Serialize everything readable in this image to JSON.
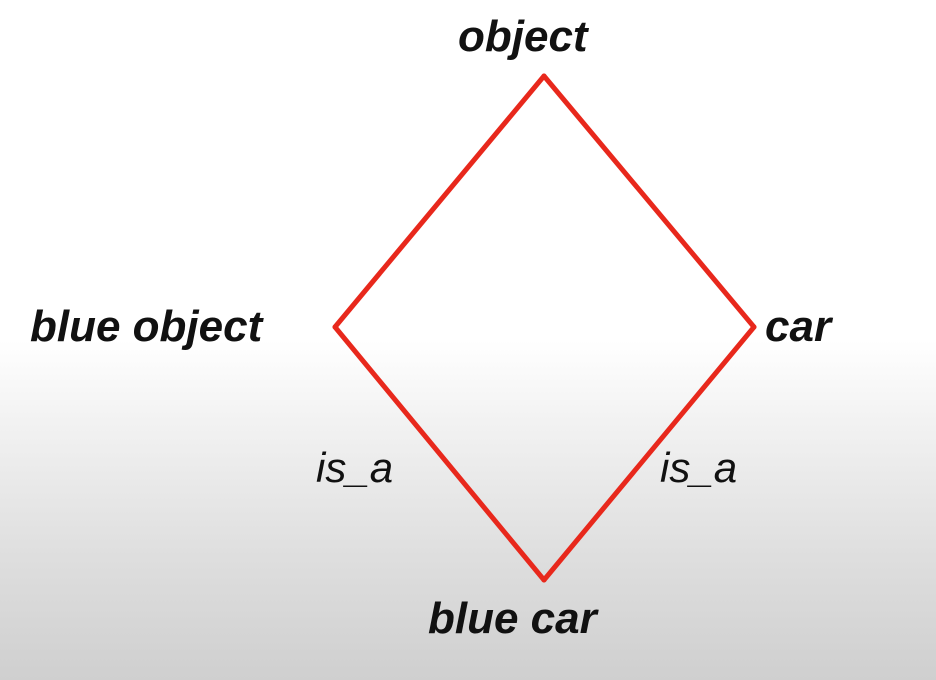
{
  "diagram": {
    "nodes": {
      "top": "object",
      "left": "blue object",
      "right": "car",
      "bottom": "blue car"
    },
    "edges": [
      {
        "from": "blue car",
        "to": "blue object",
        "label": "is_a"
      },
      {
        "from": "blue car",
        "to": "car",
        "label": "is_a"
      },
      {
        "from": "blue object",
        "to": "object",
        "label": ""
      },
      {
        "from": "car",
        "to": "object",
        "label": ""
      }
    ],
    "edge_color": "#e8281c",
    "text_color": "#111111"
  }
}
